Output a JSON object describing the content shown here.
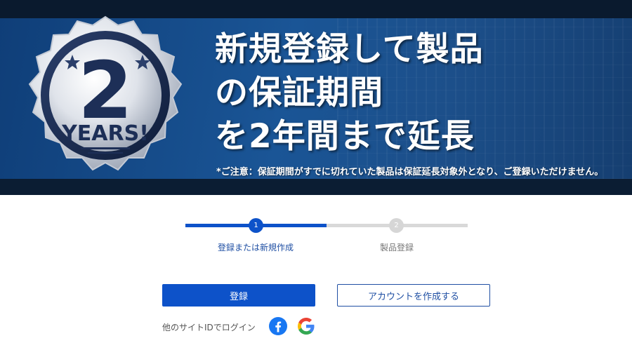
{
  "banner": {
    "badge": {
      "number": "2",
      "word": "YEARS!"
    },
    "headline": [
      "新規登録して製品",
      "の保証期間",
      "を2年間まで延長"
    ],
    "notice": "*ご注意：保証期間がすでに切れていた製品は保証延長対象外となり、ご登録いただけません。"
  },
  "stepper": {
    "steps": [
      {
        "number": "1",
        "label": "登録または新規作成",
        "state": "active"
      },
      {
        "number": "2",
        "label": "製品登録",
        "state": "inactive"
      }
    ],
    "progress_fraction": 0.5
  },
  "actions": {
    "login_label": "登録",
    "create_account_label": "アカウントを作成する"
  },
  "social": {
    "label": "他のサイトIDでログイン",
    "providers": [
      {
        "icon": "facebook-icon",
        "color": "#1877F2"
      },
      {
        "icon": "google-icon"
      }
    ]
  },
  "colors": {
    "primary": "#0D52C9",
    "banner_blue": "#1A5596",
    "track_inactive": "#D9D9D9"
  }
}
